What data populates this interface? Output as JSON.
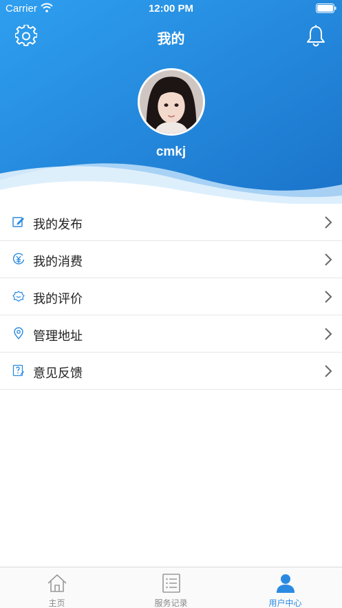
{
  "status_bar": {
    "carrier": "Carrier",
    "time": "12:00 PM"
  },
  "header": {
    "title": "我的"
  },
  "profile": {
    "username": "cmkj"
  },
  "menu": [
    {
      "label": "我的发布",
      "icon": "edit-icon"
    },
    {
      "label": "我的消费",
      "icon": "yen-icon"
    },
    {
      "label": "我的评价",
      "icon": "review-icon"
    },
    {
      "label": "管理地址",
      "icon": "location-icon"
    },
    {
      "label": "意见反馈",
      "icon": "feedback-icon"
    }
  ],
  "tabbar": [
    {
      "label": "主页",
      "icon": "home-icon",
      "active": false
    },
    {
      "label": "服务记录",
      "icon": "list-icon",
      "active": false
    },
    {
      "label": "用户中心",
      "icon": "user-icon",
      "active": true
    }
  ],
  "colors": {
    "accent": "#2a8ae2",
    "header_light": "#2f9ff0",
    "header_dark": "#1a73c9",
    "text": "#222222"
  }
}
